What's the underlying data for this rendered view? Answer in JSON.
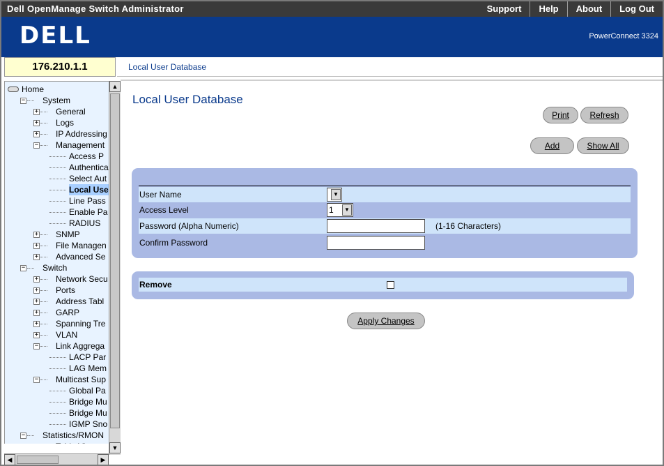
{
  "app": {
    "title": "Dell OpenManage Switch Administrator"
  },
  "top_links": [
    "Support",
    "Help",
    "About",
    "Log Out"
  ],
  "banner": {
    "logo": "DELL",
    "product": "PowerConnect 3324"
  },
  "device_ip": "176.210.1.1",
  "breadcrumb": "Local User Database",
  "tree": {
    "items": [
      {
        "label": "Home",
        "level": 0,
        "expander": "",
        "icon": "home-icon"
      },
      {
        "label": "System",
        "level": 1,
        "expander": "−"
      },
      {
        "label": "General",
        "level": 2,
        "expander": "+"
      },
      {
        "label": "Logs",
        "level": 2,
        "expander": "+"
      },
      {
        "label": "IP Addressing",
        "level": 2,
        "expander": "+"
      },
      {
        "label": "Management",
        "level": 2,
        "expander": "−"
      },
      {
        "label": "Access P",
        "level": 3,
        "expander": ""
      },
      {
        "label": "Authentica",
        "level": 3,
        "expander": ""
      },
      {
        "label": "Select Aut",
        "level": 3,
        "expander": ""
      },
      {
        "label": "Local Use",
        "level": 3,
        "expander": "",
        "selected": true
      },
      {
        "label": "Line Pass",
        "level": 3,
        "expander": ""
      },
      {
        "label": "Enable Pa",
        "level": 3,
        "expander": ""
      },
      {
        "label": "RADIUS",
        "level": 3,
        "expander": ""
      },
      {
        "label": "SNMP",
        "level": 2,
        "expander": "+"
      },
      {
        "label": "File Managen",
        "level": 2,
        "expander": "+"
      },
      {
        "label": "Advanced Se",
        "level": 2,
        "expander": "+"
      },
      {
        "label": "Switch",
        "level": 1,
        "expander": "−"
      },
      {
        "label": "Network Secu",
        "level": 2,
        "expander": "+"
      },
      {
        "label": "Ports",
        "level": 2,
        "expander": "+"
      },
      {
        "label": "Address Tabl",
        "level": 2,
        "expander": "+"
      },
      {
        "label": "GARP",
        "level": 2,
        "expander": "+"
      },
      {
        "label": "Spanning Tre",
        "level": 2,
        "expander": "+"
      },
      {
        "label": "VLAN",
        "level": 2,
        "expander": "+"
      },
      {
        "label": "Link Aggrega",
        "level": 2,
        "expander": "−"
      },
      {
        "label": "LACP Par",
        "level": 3,
        "expander": ""
      },
      {
        "label": "LAG Mem",
        "level": 3,
        "expander": ""
      },
      {
        "label": "Multicast Sup",
        "level": 2,
        "expander": "−"
      },
      {
        "label": "Global Pa",
        "level": 3,
        "expander": ""
      },
      {
        "label": "Bridge Mu",
        "level": 3,
        "expander": ""
      },
      {
        "label": "Bridge Mu",
        "level": 3,
        "expander": ""
      },
      {
        "label": "IGMP Sno",
        "level": 3,
        "expander": ""
      },
      {
        "label": "Statistics/RMON",
        "level": 1,
        "expander": "−"
      },
      {
        "label": "Table Views",
        "level": 2,
        "expander": "+"
      }
    ]
  },
  "page": {
    "title": "Local User Database",
    "buttons": {
      "print": "Print",
      "refresh": "Refresh",
      "add": "Add",
      "show_all": "Show All",
      "apply": "Apply Changes"
    },
    "form": {
      "user_name_label": "User Name",
      "user_name_value": "",
      "access_level_label": "Access Level",
      "access_level_value": "1",
      "password_label": "Password (Alpha Numeric)",
      "password_value": "",
      "password_hint": "(1-16 Characters)",
      "confirm_label": "Confirm Password",
      "confirm_value": ""
    },
    "remove": {
      "label": "Remove",
      "checked": false
    }
  },
  "colors": {
    "banner": "#0a3a8c",
    "panel": "#aab9e4",
    "row_light": "#cfe4fa",
    "tree_bg": "#e8f3ff",
    "selected": "#a8cfff"
  }
}
